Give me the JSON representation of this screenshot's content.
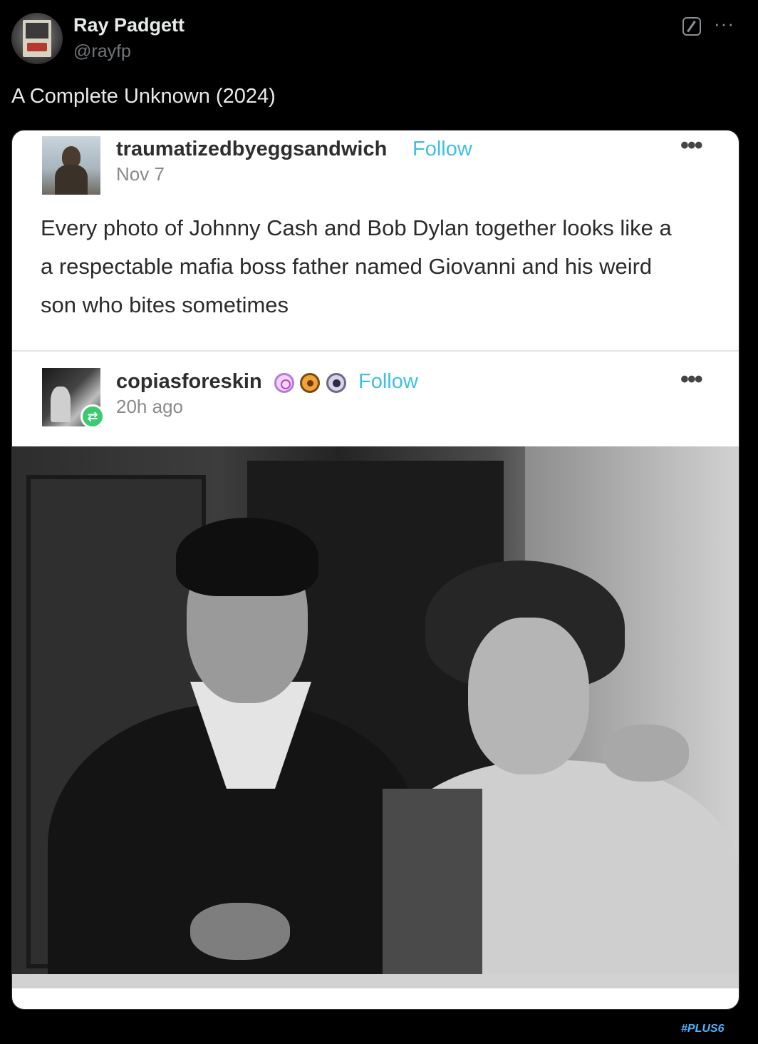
{
  "tweet": {
    "author": {
      "display_name": "Ray Padgett",
      "handle": "@rayfp"
    },
    "text": "A Complete Unknown (2024)",
    "more_icon": "ellipsis-icon",
    "grok_icon": "grok-icon"
  },
  "embed": {
    "post": {
      "username": "traumatizedbyeggsandwich",
      "follow_label": "Follow",
      "date": "Nov 7",
      "body": "Every photo of Johnny Cash and Bob Dylan together looks like a a respectable mafia boss father named Giovanni and his weird son who bites sometimes"
    },
    "reblog": {
      "username": "copiasforeskin",
      "follow_label": "Follow",
      "date": "20h ago"
    },
    "accent_color": "#3ebfe4"
  },
  "watermark": {
    "prefix": "#",
    "brand": "PLUS",
    "suffix": "6"
  }
}
